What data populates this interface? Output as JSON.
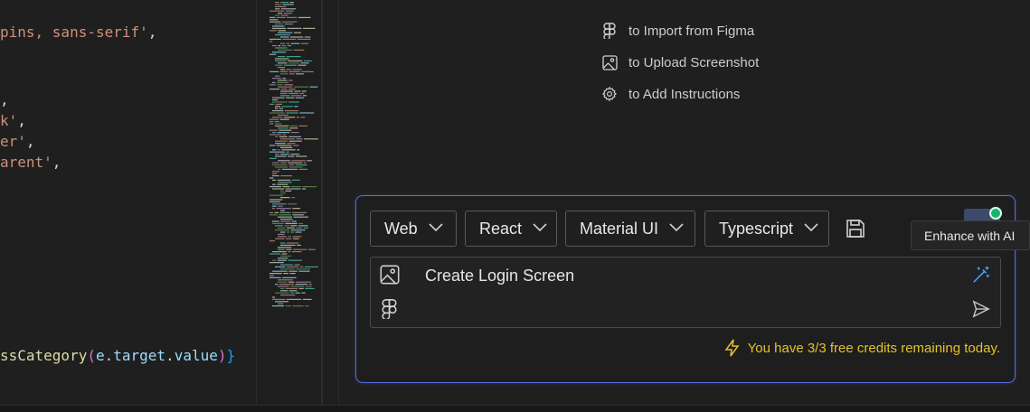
{
  "editor": {
    "lines": [
      {
        "text": "pins, sans-serif'",
        "suffix": ","
      },
      {
        "text": "",
        "suffix": ","
      },
      {
        "text": "k'",
        "suffix": ","
      },
      {
        "text": "er'",
        "suffix": ","
      },
      {
        "text": "arent'",
        "suffix": ","
      }
    ],
    "handler_line": {
      "fn": "ssCategory",
      "open": "(",
      "obj": "e",
      "dot1": ".",
      "prop1": "target",
      "dot2": ".",
      "prop2": "value",
      "close": ")",
      "brace": "}"
    }
  },
  "hints": [
    {
      "icon": "figma-icon",
      "label": "to Import from Figma"
    },
    {
      "icon": "image-icon",
      "label": "to Upload Screenshot"
    },
    {
      "icon": "gear-icon",
      "label": "to Add Instructions"
    }
  ],
  "composer": {
    "selectors": [
      {
        "label": "Web"
      },
      {
        "label": "React"
      },
      {
        "label": "Material UI"
      },
      {
        "label": "Typescript"
      }
    ],
    "prompt_text": "Create Login Screen",
    "credits_text": "You have 3/3 free credits remaining today.",
    "tooltip": "Enhance with AI"
  },
  "colors": {
    "accent_border": "#5b6de0",
    "credits": "#e2c22c",
    "enhance_dot": "#18b36b"
  }
}
